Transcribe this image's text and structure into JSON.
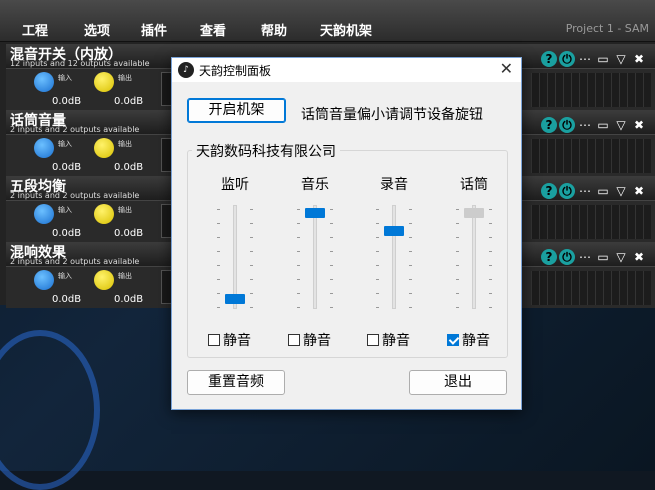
{
  "menu": [
    "工程",
    "选项",
    "插件",
    "查看",
    "帮助",
    "天韵机架"
  ],
  "app_title": "Project 1 - SAM",
  "racks": [
    {
      "title": "混音开关（内放）",
      "subtitle": "12 inputs and 12 outputs available",
      "in_label": "输入",
      "out_label": "输出",
      "in_value": "0.0dB",
      "out_value": "0.0dB"
    },
    {
      "title": "话筒音量",
      "subtitle": "2 inputs and 2 outputs available",
      "in_label": "输入",
      "out_label": "输出",
      "in_value": "0.0dB",
      "out_value": "0.0dB"
    },
    {
      "title": "五段均衡",
      "subtitle": "2 inputs and 2 outputs available",
      "in_label": "输入",
      "out_label": "输出",
      "in_value": "0.0dB",
      "out_value": "0.0dB"
    },
    {
      "title": "混响效果",
      "subtitle": "2 inputs and 2 outputs available",
      "in_label": "输入",
      "out_label": "输出",
      "in_value": "0.0dB",
      "out_value": "0.0dB"
    }
  ],
  "dialog": {
    "title": "天韵控制面板",
    "open_rack": "开启机架",
    "hint": "话筒音量偏小请调节设备旋钮",
    "group_title": "天韵数码科技有限公司",
    "channels": [
      {
        "label": "监听",
        "level": 0.05,
        "mute_label": "静音",
        "muted": false,
        "enabled": true
      },
      {
        "label": "音乐",
        "level": 0.97,
        "mute_label": "静音",
        "muted": false,
        "enabled": true
      },
      {
        "label": "录音",
        "level": 0.78,
        "mute_label": "静音",
        "muted": false,
        "enabled": true
      },
      {
        "label": "话筒",
        "level": 0.97,
        "mute_label": "静音",
        "muted": true,
        "enabled": false
      }
    ],
    "reset": "重置音频",
    "exit": "退出"
  },
  "colors": {
    "accent": "#0078d7",
    "knob_blue": "#1a6fd0",
    "knob_yellow": "#e0c800",
    "teal": "#1aa0a0"
  }
}
